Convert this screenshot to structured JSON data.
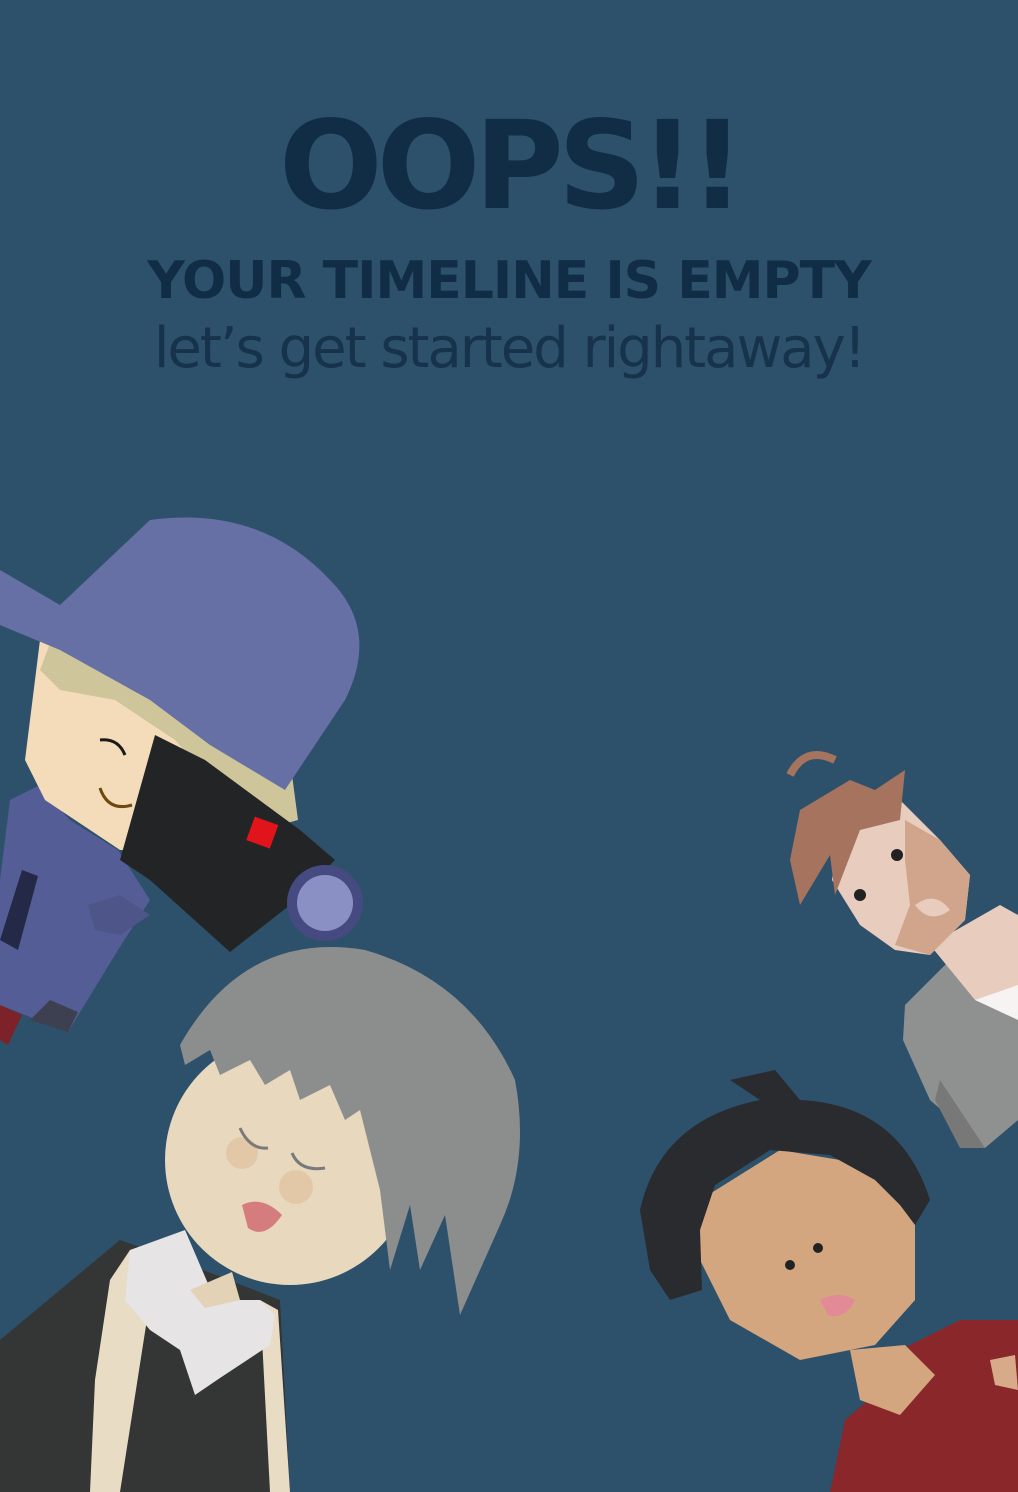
{
  "empty_state": {
    "headline": "OOPS!!",
    "subheadline": "YOUR TIMELINE IS EMPTY",
    "tagline": "let’s get started rightaway!"
  },
  "colors": {
    "background": "#2d506b",
    "text_dark": "#112d46",
    "hat_purple": "#6770a4",
    "camera_black": "#232426",
    "record_red": "#e2141b"
  },
  "icons": [
    "camera-icon"
  ]
}
